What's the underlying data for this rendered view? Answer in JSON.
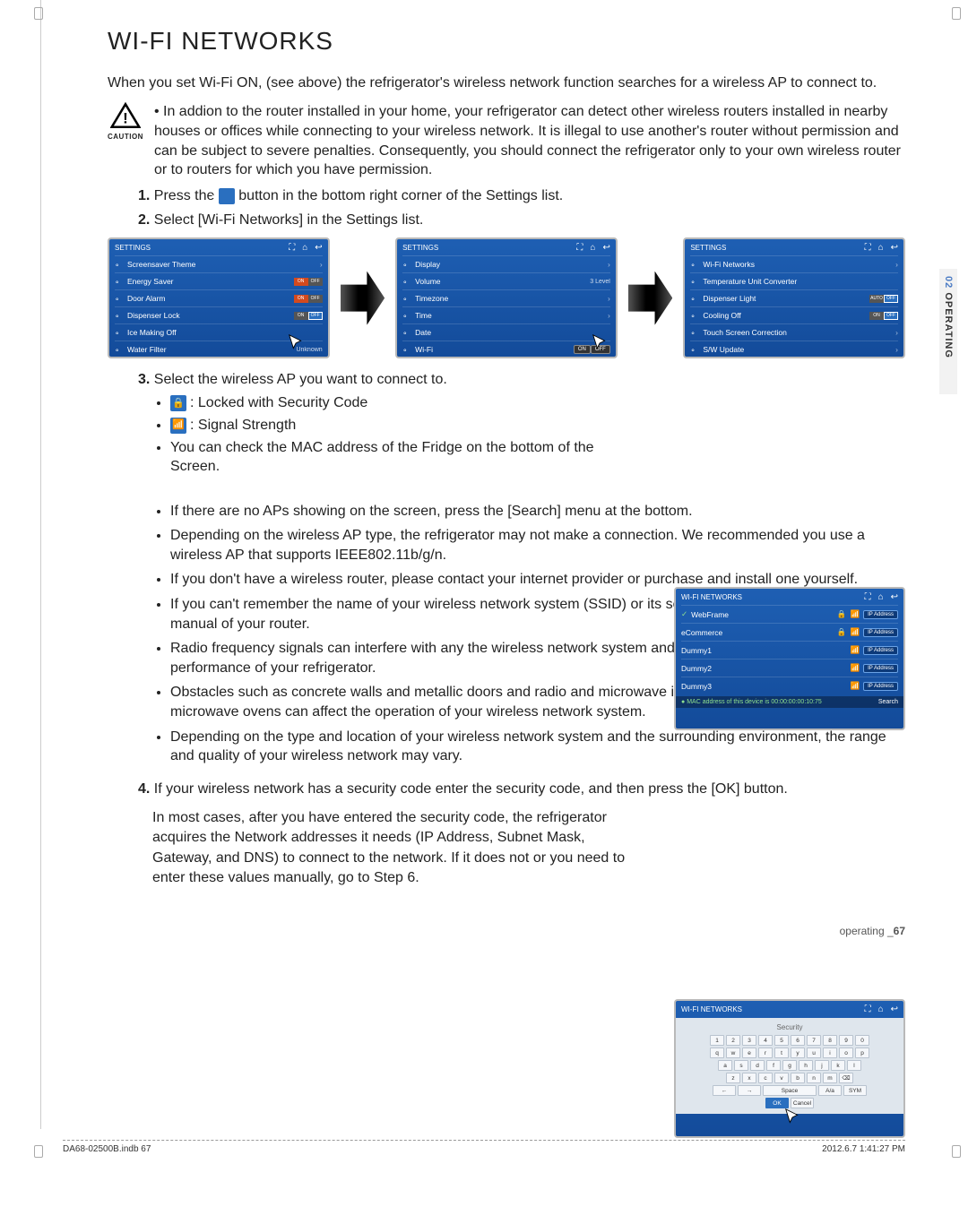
{
  "title": "WI-FI NETWORKS",
  "intro": "When you set Wi-Fi ON, (see above) the refrigerator's wireless network function searches for a wireless AP to connect to.",
  "caution_label": "CAUTION",
  "caution_text": "In addion to the router installed in your home, your refrigerator can detect other wireless routers installed in nearby houses or offices while connecting to your wireless network. It is illegal to use another's router without permission and can be subject to severe penalties. Consequently, you should connect the refrigerator only to your own wireless router or to routers for which you have permission.",
  "step1_pre": "Press the ",
  "step1_post": " button in the bottom right corner of the Settings list.",
  "step2": "Select [Wi-Fi Networks] in the Settings list.",
  "step3": "Select the wireless AP you want to connect to.",
  "step3_b1": ": Locked with Security Code",
  "step3_b2": ": Signal Strength",
  "step3_b3": "You can check the MAC address of the Fridge on the bottom of the Screen.",
  "notes": [
    "If there are no APs showing on the screen, press the [Search] menu at the bottom.",
    "Depending on the wireless AP type, the refrigerator may not make a connection. We recommended you use a wireless AP that supports IEEE802.11b/g/n.",
    "If you don't have a wireless router, please contact your internet provider or purchase and install one yourself.",
    "If you can't remember the name of your wireless network system (SSID) or its security code, please see the user manual of your router.",
    "Radio frequency signals can interfere with any the wireless network system and they may affect the network performance of your refrigerator.",
    "Obstacles such as concrete walls and metallic doors and radio and microwave interference from devices such as microwave ovens can affect the operation of your wireless network system.",
    "Depending on the type and location of your wireless network system and the surrounding environment, the range and quality of your wireless network may vary."
  ],
  "step4": "If your wireless network has a security code enter the security code, and then press the [OK] button.",
  "step4_para": "In most cases, after you have entered the security code, the refrigerator acquires the Network addresses it needs (IP Address, Subnet Mask, Gateway, and DNS) to connect to the network. If it does not or you need to enter these values manually, go to Step 6.",
  "settings_hdr": "SETTINGS",
  "left_screen": [
    {
      "l": "Screensaver Theme",
      "r": "arrow"
    },
    {
      "l": "Energy Saver",
      "r": "onoff_on"
    },
    {
      "l": "Door Alarm",
      "r": "onoff_on"
    },
    {
      "l": "Dispenser Lock",
      "r": "onoff_off"
    },
    {
      "l": "Ice Making Off",
      "r": "none"
    },
    {
      "l": "Water Filter",
      "r": "Unknown"
    }
  ],
  "mid_screen": [
    {
      "l": "Display",
      "r": "arrow"
    },
    {
      "l": "Volume",
      "r": "3 Level"
    },
    {
      "l": "Timezone",
      "r": "arrow"
    },
    {
      "l": "Time",
      "r": "arrow"
    },
    {
      "l": "Date",
      "r": "none"
    },
    {
      "l": "Wi-Fi",
      "r": "onoff"
    }
  ],
  "right_screen": [
    {
      "l": "Wi-Fi Networks",
      "r": "arrow"
    },
    {
      "l": "Temperature Unit Converter",
      "r": "none"
    },
    {
      "l": "Dispenser Light",
      "r": "autooff"
    },
    {
      "l": "Cooling Off",
      "r": "onoff_off"
    },
    {
      "l": "Touch Screen Correction",
      "r": "arrow"
    },
    {
      "l": "S/W Update",
      "r": "arrow"
    }
  ],
  "wifi_hdr": "WI-FI NETWORKS",
  "wifi_list": [
    {
      "n": "WebFrame",
      "lock": true,
      "sig": true,
      "sel": true
    },
    {
      "n": "eCommerce",
      "lock": true,
      "sig": true
    },
    {
      "n": "Dummy1",
      "lock": false,
      "sig": true
    },
    {
      "n": "Dummy2",
      "lock": false,
      "sig": true
    },
    {
      "n": "Dummy3",
      "lock": false,
      "sig": true
    }
  ],
  "ip_btn": "IP Address",
  "mac_txt": "MAC address of this device is 00:00:00:00:10:75",
  "search": "Search",
  "kb_title": "Security",
  "kb_rows": [
    [
      "1",
      "2",
      "3",
      "4",
      "5",
      "6",
      "7",
      "8",
      "9",
      "0"
    ],
    [
      "q",
      "w",
      "e",
      "r",
      "t",
      "y",
      "u",
      "i",
      "o",
      "p"
    ],
    [
      "a",
      "s",
      "d",
      "f",
      "g",
      "h",
      "j",
      "k",
      "l"
    ],
    [
      "z",
      "x",
      "c",
      "v",
      "b",
      "n",
      "m",
      "⌫"
    ]
  ],
  "kb_ctrl": [
    "←",
    "→",
    "Space",
    "A/a",
    "SYM"
  ],
  "kb_ok": "OK",
  "kb_cancel": "Cancel",
  "side_tab_num": "02",
  "side_tab_txt": "OPERATING",
  "footer_pg_lbl": "operating _",
  "footer_pg_num": "67",
  "footer_left": "DA68-02500B.indb   67",
  "footer_right": "2012.6.7   1:41:27 PM",
  "on": "ON",
  "off": "OFF",
  "auto": "AUTO"
}
